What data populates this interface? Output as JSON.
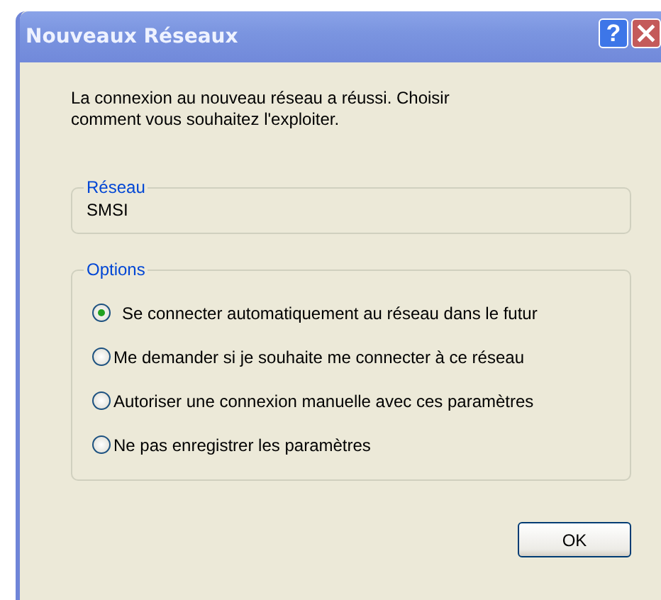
{
  "window": {
    "title": "Nouveaux Réseaux",
    "buttons": [
      {
        "kind": "help",
        "label": "?"
      },
      {
        "kind": "close"
      }
    ]
  },
  "message": "La connexion au nouveau réseau a réussi. Choisir comment vous souhaitez l'exploiter.",
  "network_group": {
    "label": "Réseau",
    "value": "SMSI"
  },
  "options_group": {
    "label": "Options",
    "options": [
      {
        "label": "Se connecter automatiquement au réseau dans le futur",
        "selected": true
      },
      {
        "label": "Me demander si je souhaite me connecter à ce réseau",
        "selected": false
      },
      {
        "label": "Autoriser une connexion manuelle avec ces paramètres",
        "selected": false
      },
      {
        "label": "Ne pas enregistrer les paramètres",
        "selected": false
      }
    ]
  },
  "buttons": [
    "OK"
  ]
}
